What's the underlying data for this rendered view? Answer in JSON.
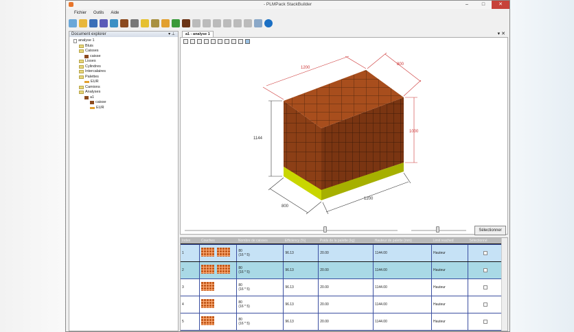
{
  "window": {
    "title": "- PLMPack StackBuilder",
    "min": "–",
    "max": "□",
    "close": "✕"
  },
  "menu": [
    "Fichier",
    "Outils",
    "Aide"
  ],
  "toolbar_icons": [
    "new-doc",
    "open",
    "save",
    "save-all",
    "bundle",
    "case",
    "box",
    "cylinder",
    "interlayer",
    "pallet",
    "truck",
    "analysis",
    "disabled-1",
    "disabled-2",
    "disabled-3",
    "disabled-4",
    "disabled-5",
    "disabled-6",
    "database",
    "help"
  ],
  "explorer": {
    "title": "Document explorer",
    "pin": "▾ ⊥",
    "tree": [
      {
        "label": "analyse 1",
        "level": 0,
        "icon": "doc"
      },
      {
        "label": "Bluis",
        "level": 1,
        "icon": "folder"
      },
      {
        "label": "Caisses",
        "level": 1,
        "icon": "folder"
      },
      {
        "label": "caisse",
        "level": 2,
        "icon": "box"
      },
      {
        "label": "Lisses",
        "level": 1,
        "icon": "folder"
      },
      {
        "label": "Cylindres",
        "level": 1,
        "icon": "folder"
      },
      {
        "label": "Intercalaires",
        "level": 1,
        "icon": "folder"
      },
      {
        "label": "Palettes",
        "level": 1,
        "icon": "folder"
      },
      {
        "label": "EUR",
        "level": 2,
        "icon": "pallet"
      },
      {
        "label": "Camions",
        "level": 1,
        "icon": "folder"
      },
      {
        "label": "Analyses",
        "level": 1,
        "icon": "folder"
      },
      {
        "label": "a1",
        "level": 2,
        "icon": "box"
      },
      {
        "label": "caisse",
        "level": 3,
        "icon": "box"
      },
      {
        "label": "EUR",
        "level": 3,
        "icon": "pallet"
      }
    ]
  },
  "tab": {
    "label": "a1 - analyse 1",
    "close": "▾ ✕"
  },
  "view": {
    "dim_length": "1200",
    "dim_width": "800",
    "dim_height": "1000",
    "dim_total": "1144",
    "dim_bottom_length": "1200",
    "dim_bottom_width": "800"
  },
  "select_button": "Sélectionner",
  "grid": {
    "headers": [
      "Index",
      "Couches",
      "Nombre de caisses",
      "Efficiency (%)",
      "Poids de la palette (kg)",
      "Hauteur de palette (mm)",
      "Limit reached",
      "Sélectionné"
    ],
    "rows": [
      {
        "index": "1",
        "count": "80",
        "detail": "(16 * 5)",
        "eff": "96.13",
        "weight": "20.00",
        "height": "1144.00",
        "limit": "Hauteur"
      },
      {
        "index": "2",
        "count": "80",
        "detail": "(16 * 5)",
        "eff": "96.13",
        "weight": "20.00",
        "height": "1144.00",
        "limit": "Hauteur"
      },
      {
        "index": "3",
        "count": "80",
        "detail": "(16 * 5)",
        "eff": "96.13",
        "weight": "20.00",
        "height": "1144.00",
        "limit": "Hauteur"
      },
      {
        "index": "4",
        "count": "80",
        "detail": "(16 * 5)",
        "eff": "96.13",
        "weight": "20.00",
        "height": "1144.00",
        "limit": "Hauteur"
      },
      {
        "index": "5",
        "count": "80",
        "detail": "(16 * 5)",
        "eff": "96.13",
        "weight": "20.00",
        "height": "1144.00",
        "limit": "Hauteur"
      }
    ]
  }
}
